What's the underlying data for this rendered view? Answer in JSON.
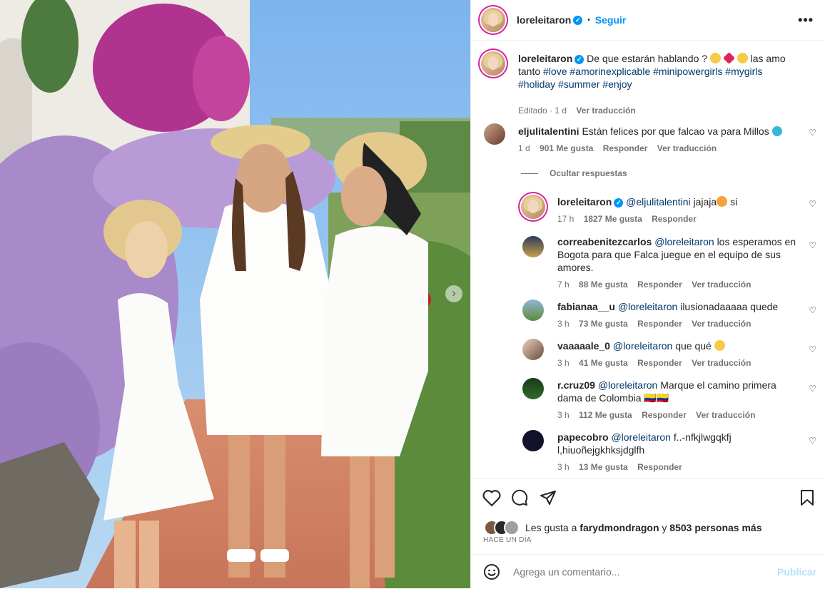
{
  "post": {
    "username": "loreleitaron",
    "follow_label": "Seguir",
    "more_label": "•••"
  },
  "caption": {
    "username": "loreleitaron",
    "text_before": "De que estarán hablando ?",
    "text_after": "las amo tanto",
    "hashtags": [
      "#love",
      "#amorinexplicable",
      "#minipowergirls",
      "#mygirls",
      "#holiday",
      "#summer",
      "#enjoy"
    ],
    "edited": "Editado · 1 d",
    "translate": "Ver traducción"
  },
  "comments": [
    {
      "username": "eljulitalentini",
      "text": "Están felices por que falcao va para Millos",
      "time": "1 d",
      "likes": "901 Me gusta",
      "reply": "Responder",
      "translate": "Ver traducción",
      "hide_replies": "Ocultar respuestas"
    }
  ],
  "replies": [
    {
      "username": "loreleitaron",
      "mention": "@eljulitalentini",
      "text": "jajaja",
      "text2": "si",
      "time": "17 h",
      "likes": "1827 Me gusta",
      "reply": "Responder",
      "translate": ""
    },
    {
      "username": "correabenitezcarlos",
      "mention": "@loreleitaron",
      "text": "los esperamos en Bogota para que Falca juegue en el equipo de sus amores.",
      "time": "7 h",
      "likes": "88 Me gusta",
      "reply": "Responder",
      "translate": "Ver traducción"
    },
    {
      "username": "fabianaa__u",
      "mention": "@loreleitaron",
      "text": "ilusionadaaaaa quede",
      "time": "3 h",
      "likes": "73 Me gusta",
      "reply": "Responder",
      "translate": "Ver traducción"
    },
    {
      "username": "vaaaaale_0",
      "mention": "@loreleitaron",
      "text": "que qué",
      "time": "3 h",
      "likes": "41 Me gusta",
      "reply": "Responder",
      "translate": "Ver traducción"
    },
    {
      "username": "r.cruz09",
      "mention": "@loreleitaron",
      "text": "Marque el camino primera dama de Colombia 🇨🇴🇨🇴",
      "time": "3 h",
      "likes": "112 Me gusta",
      "reply": "Responder",
      "translate": "Ver traducción"
    },
    {
      "username": "papecobro",
      "mention": "@loreleitaron",
      "text": "f..-nfkjlwgqkfjl,hiuoñejgkhksjdglfh",
      "time": "3 h",
      "likes": "13 Me gusta",
      "reply": "Responder",
      "translate": ""
    }
  ],
  "likes": {
    "prefix": "Les gusta a",
    "user": "farydmondragon",
    "joiner": "y",
    "others": "8503 personas más",
    "date": "HACE UN DÍA"
  },
  "compose": {
    "placeholder": "Agrega un comentario...",
    "publish": "Publicar"
  },
  "colors": {
    "accent": "#0095f6",
    "link": "#00376b",
    "muted": "#737373"
  }
}
